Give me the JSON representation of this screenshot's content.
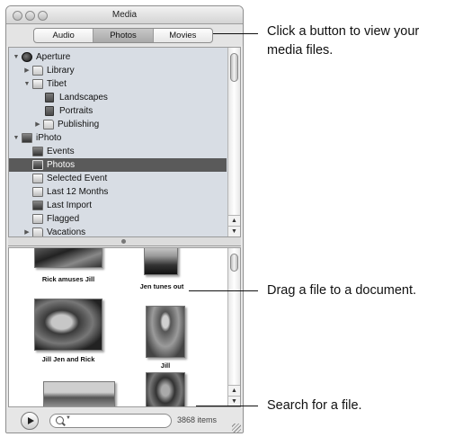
{
  "window": {
    "title": "Media",
    "tabs": [
      "Audio",
      "Photos",
      "Movies"
    ],
    "active_tab": "Photos"
  },
  "source_list": {
    "items": [
      {
        "label": "Aperture",
        "disclosure": "open",
        "icon": "aperture-icon"
      },
      {
        "label": "Library",
        "disclosure": "closed",
        "icon": "library-icon"
      },
      {
        "label": "Tibet",
        "disclosure": "open",
        "icon": "project-icon"
      },
      {
        "label": "Landscapes",
        "disclosure": "",
        "icon": "album-icon"
      },
      {
        "label": "Portraits",
        "disclosure": "",
        "icon": "album-icon"
      },
      {
        "label": "Publishing",
        "disclosure": "closed",
        "icon": "folder-icon"
      },
      {
        "label": "iPhoto",
        "disclosure": "open",
        "icon": "iphoto-icon"
      },
      {
        "label": "Events",
        "disclosure": "",
        "icon": "events-icon"
      },
      {
        "label": "Photos",
        "disclosure": "",
        "icon": "photos-icon",
        "selected": true
      },
      {
        "label": "Selected Event",
        "disclosure": "",
        "icon": "event-icon"
      },
      {
        "label": "Last 12 Months",
        "disclosure": "",
        "icon": "calendar-icon"
      },
      {
        "label": "Last Import",
        "disclosure": "",
        "icon": "import-icon"
      },
      {
        "label": "Flagged",
        "disclosure": "",
        "icon": "flag-icon"
      },
      {
        "label": "Vacations",
        "disclosure": "closed",
        "icon": "folder-icon"
      }
    ]
  },
  "media_items": [
    {
      "caption": "Rick amuses Jill"
    },
    {
      "caption": "Jen tunes out"
    },
    {
      "caption": "Jill Jen and Rick"
    },
    {
      "caption": "Jill"
    },
    {
      "caption": ""
    },
    {
      "caption": ""
    }
  ],
  "bottom": {
    "search_value": "",
    "item_count": "3868 items"
  },
  "callouts": [
    "Click a button to view your media files.",
    "Drag a file to a document.",
    "Search for a file."
  ]
}
